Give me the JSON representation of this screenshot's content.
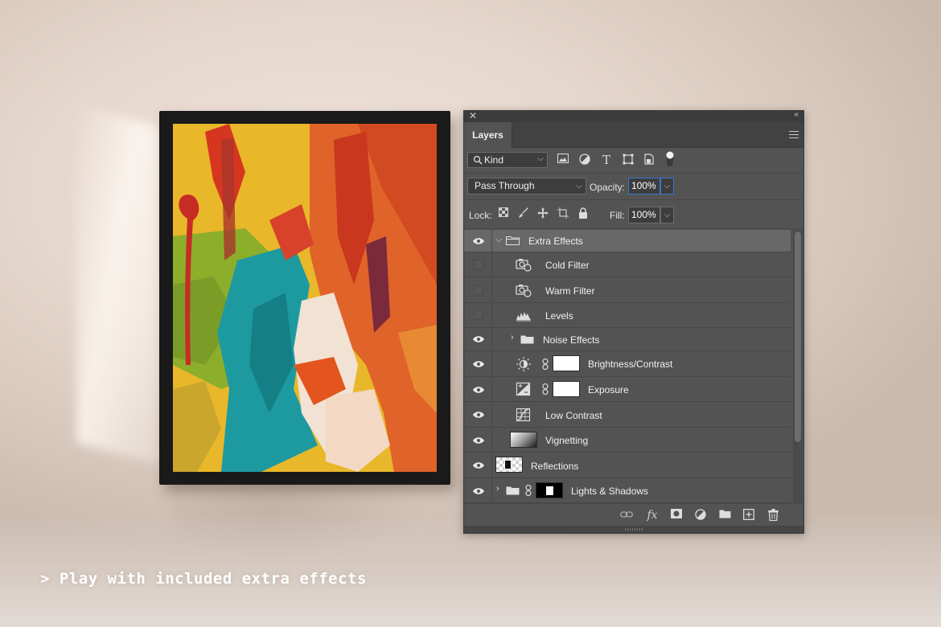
{
  "panel": {
    "title": "Layers",
    "filter": {
      "kind_label": "Kind"
    },
    "blend_mode": "Pass Through",
    "opacity_label": "Opacity:",
    "opacity_value": "100%",
    "lock_label": "Lock:",
    "fill_label": "Fill:",
    "fill_value": "100%",
    "layers": [
      {
        "name": "Extra Effects",
        "type": "group",
        "expanded": true,
        "visible": true,
        "selected": true
      },
      {
        "name": "Cold Filter",
        "type": "photo-filter",
        "visible": false
      },
      {
        "name": "Warm Filter",
        "type": "photo-filter",
        "visible": false
      },
      {
        "name": "Levels",
        "type": "levels",
        "visible": false
      },
      {
        "name": "Noise Effects",
        "type": "group",
        "expanded": false,
        "visible": true
      },
      {
        "name": "Brightness/Contrast",
        "type": "brightness-contrast",
        "visible": true,
        "mask": "white"
      },
      {
        "name": "Exposure",
        "type": "exposure",
        "visible": true,
        "mask": "white"
      },
      {
        "name": "Low Contrast",
        "type": "curves",
        "visible": true
      },
      {
        "name": "Vignetting",
        "type": "pixel",
        "visible": true
      },
      {
        "name": "Reflections",
        "type": "pixel",
        "visible": true
      },
      {
        "name": "Lights & Shadows",
        "type": "group",
        "expanded": false,
        "visible": true,
        "mask": "black-white"
      }
    ],
    "footer_icons": [
      "link-icon",
      "fx-icon",
      "mask-icon",
      "adjustment-icon",
      "new-group-icon",
      "new-layer-icon",
      "trash-icon"
    ]
  },
  "caption": "> Play with included extra effects",
  "colors": {
    "panel_bg": "#535353",
    "selected_row": "#686868",
    "focus_blue": "#3b78c9"
  }
}
